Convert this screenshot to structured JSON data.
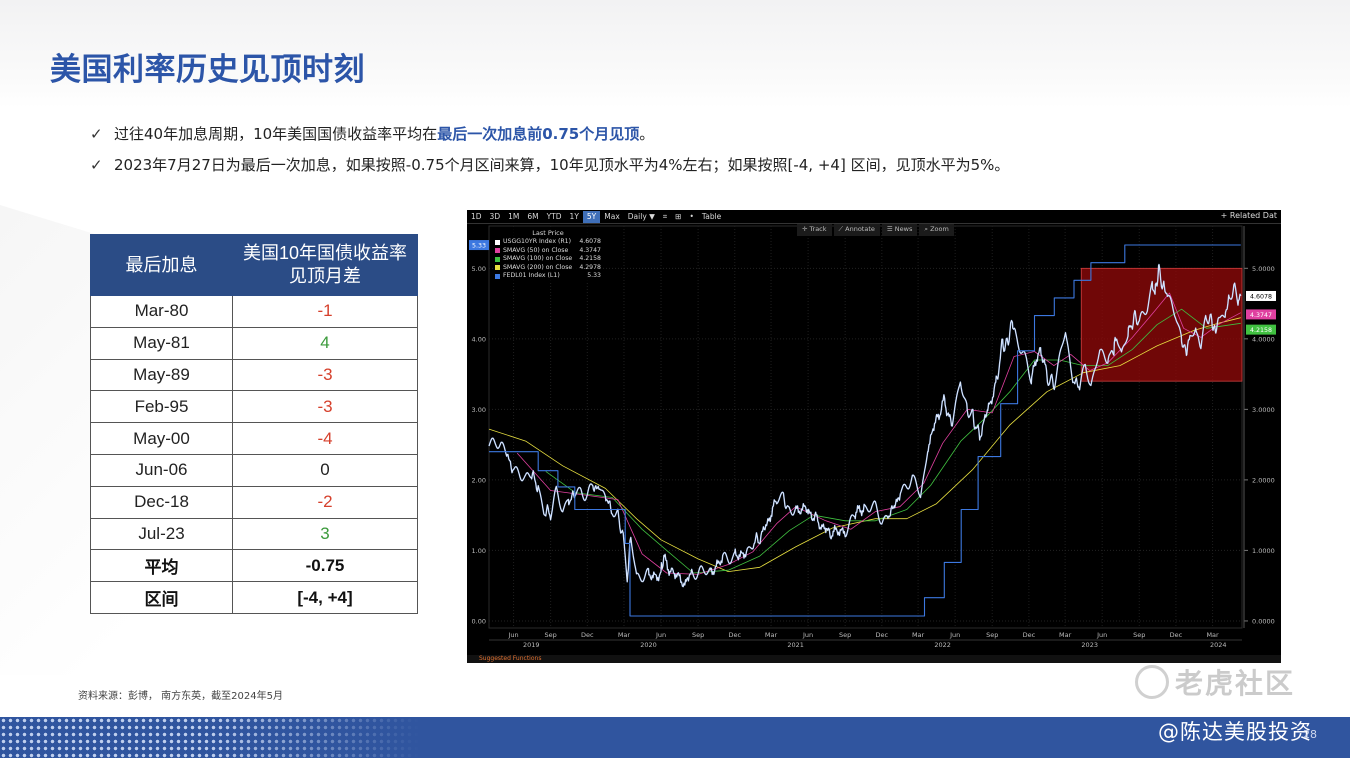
{
  "title": "美国利率历史见顶时刻",
  "bullets": [
    {
      "check": "✓",
      "text_before": "过往40年加息周期，10年美国国债收益率平均在",
      "highlight": "最后一次加息前0.75个月见顶",
      "text_after": "。"
    },
    {
      "check": "✓",
      "text_before": "2023年7月27日为最后一次加息，如果按照-0.75个月区间来算，10年见顶水平为4%左右；如果按照[-4, +4] 区间，见顶水平为5%。",
      "highlight": "",
      "text_after": ""
    }
  ],
  "table": {
    "headers": [
      "最后加息",
      "美国10年国债收益率\n见顶月差"
    ],
    "rows": [
      {
        "date": "Mar-80",
        "diff": "-1",
        "sign": "neg"
      },
      {
        "date": "May-81",
        "diff": "4",
        "sign": "pos"
      },
      {
        "date": "May-89",
        "diff": "-3",
        "sign": "neg"
      },
      {
        "date": "Feb-95",
        "diff": "-3",
        "sign": "neg"
      },
      {
        "date": "May-00",
        "diff": "-4",
        "sign": "neg"
      },
      {
        "date": "Jun-06",
        "diff": "0",
        "sign": "zero"
      },
      {
        "date": "Dec-18",
        "diff": "-2",
        "sign": "neg"
      },
      {
        "date": "Jul-23",
        "diff": "3",
        "sign": "pos"
      }
    ],
    "summary": [
      {
        "label": "平均",
        "value": "-0.75"
      },
      {
        "label": "区间",
        "value": "[-4, +4]"
      }
    ]
  },
  "terminal": {
    "toolbar": [
      "1D",
      "3D",
      "1M",
      "6M",
      "YTD",
      "1Y",
      "5Y",
      "Max",
      "Daily ▼",
      "⌗",
      "⊞",
      "•",
      "Table"
    ],
    "active_period": "5Y",
    "related": "+ Related Dat",
    "tools": [
      "✛ Track",
      "⟋ Annotate",
      "☰ News",
      "⌕ Zoom"
    ],
    "bottom_text": "Suggested Functions"
  },
  "chart_data": {
    "type": "line",
    "legend_title": "Last Price",
    "legend_position": "top-left",
    "series": [
      {
        "name": "USGG10YR Index (R1)",
        "last": "4.6078",
        "color": "#ffffff"
      },
      {
        "name": "SMAVG (50) on Close",
        "last": "4.3747",
        "color": "#e040a0"
      },
      {
        "name": "SMAVG (100) on Close",
        "last": "4.2158",
        "color": "#40c040"
      },
      {
        "name": "SMAVG (200) on Close",
        "last": "4.2978",
        "color": "#e8e040"
      },
      {
        "name": "FEDL01 Index (L1)",
        "last": "5.33",
        "color": "#3c78e0"
      }
    ],
    "left_axis": {
      "ticks": [
        "0.00",
        "1.00",
        "2.00",
        "3.00",
        "4.00",
        "5.00"
      ],
      "ylim": [
        -0.1,
        5.6
      ],
      "marker": "5.33"
    },
    "right_axis": {
      "ticks": [
        "0.0000",
        "1.0000",
        "2.0000",
        "3.0000",
        "4.0000",
        "5.0000"
      ],
      "ylim": [
        -0.1,
        5.6
      ],
      "markers": [
        {
          "value": "4.6078",
          "color": "#ffffff"
        },
        {
          "value": "4.3747",
          "color": "#e040a0"
        },
        {
          "value": "4.2158",
          "color": "#40c040"
        }
      ]
    },
    "x_month_ticks": [
      "Jun",
      "Sep",
      "Dec",
      "Mar",
      "Jun",
      "Sep",
      "Dec",
      "Mar",
      "Jun",
      "Sep",
      "Dec",
      "Mar",
      "Jun",
      "Sep",
      "Dec",
      "Mar",
      "Jun",
      "Sep",
      "Dec",
      "Mar"
    ],
    "x_year_ticks": [
      "2019",
      "2020",
      "2021",
      "2022",
      "2023",
      "2024"
    ],
    "x_range": [
      "2019-04",
      "2024-05"
    ],
    "highlight_box": {
      "x_start": "2023-04",
      "x_end": "2024-05",
      "y_range": [
        3.4,
        5.0
      ]
    },
    "ust10y": [
      [
        "2019-04-01",
        2.52
      ],
      [
        "2019-05-01",
        2.5
      ],
      [
        "2019-05-15",
        2.38
      ],
      [
        "2019-06-01",
        2.12
      ],
      [
        "2019-06-15",
        2.1
      ],
      [
        "2019-07-01",
        2.03
      ],
      [
        "2019-07-15",
        2.08
      ],
      [
        "2019-08-01",
        1.92
      ],
      [
        "2019-08-15",
        1.58
      ],
      [
        "2019-09-01",
        1.5
      ],
      [
        "2019-09-15",
        1.8
      ],
      [
        "2019-10-01",
        1.62
      ],
      [
        "2019-10-15",
        1.72
      ],
      [
        "2019-11-01",
        1.78
      ],
      [
        "2019-11-15",
        1.85
      ],
      [
        "2019-12-01",
        1.8
      ],
      [
        "2019-12-15",
        1.88
      ],
      [
        "2020-01-01",
        1.9
      ],
      [
        "2020-01-15",
        1.78
      ],
      [
        "2020-02-01",
        1.55
      ],
      [
        "2020-02-15",
        1.55
      ],
      [
        "2020-03-01",
        1.1
      ],
      [
        "2020-03-09",
        0.54
      ],
      [
        "2020-03-18",
        1.18
      ],
      [
        "2020-04-01",
        0.62
      ],
      [
        "2020-04-15",
        0.66
      ],
      [
        "2020-05-01",
        0.64
      ],
      [
        "2020-06-01",
        0.68
      ],
      [
        "2020-06-08",
        0.9
      ],
      [
        "2020-07-01",
        0.66
      ],
      [
        "2020-08-01",
        0.55
      ],
      [
        "2020-08-20",
        0.7
      ],
      [
        "2020-09-01",
        0.68
      ],
      [
        "2020-10-01",
        0.72
      ],
      [
        "2020-11-01",
        0.86
      ],
      [
        "2020-11-15",
        0.9
      ],
      [
        "2020-12-01",
        0.93
      ],
      [
        "2021-01-01",
        1.0
      ],
      [
        "2021-01-15",
        1.12
      ],
      [
        "2021-02-01",
        1.15
      ],
      [
        "2021-02-20",
        1.4
      ],
      [
        "2021-03-15",
        1.68
      ],
      [
        "2021-03-31",
        1.74
      ],
      [
        "2021-04-15",
        1.58
      ],
      [
        "2021-05-01",
        1.62
      ],
      [
        "2021-06-01",
        1.55
      ],
      [
        "2021-06-20",
        1.45
      ],
      [
        "2021-07-15",
        1.3
      ],
      [
        "2021-08-01",
        1.22
      ],
      [
        "2021-09-01",
        1.3
      ],
      [
        "2021-09-25",
        1.48
      ],
      [
        "2021-10-20",
        1.65
      ],
      [
        "2021-11-15",
        1.58
      ],
      [
        "2021-12-01",
        1.44
      ],
      [
        "2021-12-15",
        1.48
      ],
      [
        "2022-01-01",
        1.62
      ],
      [
        "2022-01-20",
        1.85
      ],
      [
        "2022-02-15",
        2.02
      ],
      [
        "2022-03-07",
        1.78
      ],
      [
        "2022-03-25",
        2.45
      ],
      [
        "2022-04-15",
        2.85
      ],
      [
        "2022-05-06",
        3.12
      ],
      [
        "2022-05-25",
        2.75
      ],
      [
        "2022-06-14",
        3.48
      ],
      [
        "2022-06-30",
        2.98
      ],
      [
        "2022-07-15",
        2.92
      ],
      [
        "2022-08-01",
        2.6
      ],
      [
        "2022-08-20",
        2.98
      ],
      [
        "2022-09-10",
        3.32
      ],
      [
        "2022-09-27",
        3.95
      ],
      [
        "2022-10-10",
        3.9
      ],
      [
        "2022-10-21",
        4.25
      ],
      [
        "2022-11-01",
        4.05
      ],
      [
        "2022-11-15",
        3.8
      ],
      [
        "2022-12-07",
        3.42
      ],
      [
        "2022-12-30",
        3.88
      ],
      [
        "2023-01-18",
        3.4
      ],
      [
        "2023-02-02",
        3.4
      ],
      [
        "2023-03-02",
        4.08
      ],
      [
        "2023-03-20",
        3.45
      ],
      [
        "2023-04-06",
        3.3
      ],
      [
        "2023-04-20",
        3.58
      ],
      [
        "2023-05-04",
        3.38
      ],
      [
        "2023-05-26",
        3.8
      ],
      [
        "2023-06-15",
        3.72
      ],
      [
        "2023-06-30",
        3.84
      ],
      [
        "2023-07-07",
        4.06
      ],
      [
        "2023-07-19",
        3.76
      ],
      [
        "2023-08-04",
        4.05
      ],
      [
        "2023-08-21",
        4.34
      ],
      [
        "2023-09-01",
        4.18
      ],
      [
        "2023-09-21",
        4.48
      ],
      [
        "2023-10-03",
        4.8
      ],
      [
        "2023-10-10",
        4.62
      ],
      [
        "2023-10-19",
        4.98
      ],
      [
        "2023-11-01",
        4.75
      ],
      [
        "2023-11-10",
        4.62
      ],
      [
        "2023-11-30",
        4.35
      ],
      [
        "2023-12-14",
        4.0
      ],
      [
        "2023-12-27",
        3.8
      ],
      [
        "2024-01-05",
        4.05
      ],
      [
        "2024-01-19",
        4.15
      ],
      [
        "2024-02-01",
        3.9
      ],
      [
        "2024-02-13",
        4.3
      ],
      [
        "2024-02-28",
        4.25
      ],
      [
        "2024-03-08",
        4.08
      ],
      [
        "2024-03-19",
        4.3
      ],
      [
        "2024-04-01",
        4.33
      ],
      [
        "2024-04-10",
        4.55
      ],
      [
        "2024-04-25",
        4.7
      ],
      [
        "2024-05-03",
        4.5
      ],
      [
        "2024-05-10",
        4.61
      ]
    ],
    "fed_funds": [
      [
        "2019-04-01",
        2.4
      ],
      [
        "2019-08-01",
        2.4
      ],
      [
        "2019-08-01",
        2.13
      ],
      [
        "2019-09-19",
        2.13
      ],
      [
        "2019-09-19",
        1.9
      ],
      [
        "2019-10-31",
        1.9
      ],
      [
        "2019-10-31",
        1.58
      ],
      [
        "2020-03-04",
        1.58
      ],
      [
        "2020-03-04",
        1.1
      ],
      [
        "2020-03-16",
        1.1
      ],
      [
        "2020-03-16",
        0.07
      ],
      [
        "2022-03-17",
        0.07
      ],
      [
        "2022-03-17",
        0.33
      ],
      [
        "2022-05-05",
        0.33
      ],
      [
        "2022-05-05",
        0.83
      ],
      [
        "2022-06-16",
        0.83
      ],
      [
        "2022-06-16",
        1.58
      ],
      [
        "2022-07-28",
        1.58
      ],
      [
        "2022-07-28",
        2.33
      ],
      [
        "2022-09-22",
        2.33
      ],
      [
        "2022-09-22",
        3.08
      ],
      [
        "2022-11-03",
        3.08
      ],
      [
        "2022-11-03",
        3.83
      ],
      [
        "2022-12-15",
        3.83
      ],
      [
        "2022-12-15",
        4.33
      ],
      [
        "2023-02-02",
        4.33
      ],
      [
        "2023-02-02",
        4.58
      ],
      [
        "2023-03-23",
        4.58
      ],
      [
        "2023-03-23",
        4.83
      ],
      [
        "2023-05-04",
        4.83
      ],
      [
        "2023-05-04",
        5.08
      ],
      [
        "2023-07-27",
        5.08
      ],
      [
        "2023-07-27",
        5.33
      ],
      [
        "2024-05-10",
        5.33
      ]
    ],
    "smavg50": [
      [
        "2019-06-10",
        2.38
      ],
      [
        "2019-09-01",
        1.85
      ],
      [
        "2019-12-01",
        1.78
      ],
      [
        "2020-02-15",
        1.72
      ],
      [
        "2020-04-15",
        0.95
      ],
      [
        "2020-06-15",
        0.68
      ],
      [
        "2020-09-01",
        0.66
      ],
      [
        "2020-11-15",
        0.8
      ],
      [
        "2021-01-15",
        0.98
      ],
      [
        "2021-03-15",
        1.38
      ],
      [
        "2021-05-01",
        1.62
      ],
      [
        "2021-07-15",
        1.42
      ],
      [
        "2021-09-15",
        1.3
      ],
      [
        "2021-11-15",
        1.55
      ],
      [
        "2022-01-15",
        1.62
      ],
      [
        "2022-03-15",
        1.95
      ],
      [
        "2022-05-01",
        2.52
      ],
      [
        "2022-07-01",
        3.0
      ],
      [
        "2022-09-01",
        2.95
      ],
      [
        "2022-10-25",
        3.75
      ],
      [
        "2022-12-15",
        3.82
      ],
      [
        "2023-02-01",
        3.62
      ],
      [
        "2023-03-15",
        3.78
      ],
      [
        "2023-05-01",
        3.55
      ],
      [
        "2023-06-15",
        3.66
      ],
      [
        "2023-08-15",
        4.02
      ],
      [
        "2023-10-10",
        4.4
      ],
      [
        "2023-11-15",
        4.65
      ],
      [
        "2023-12-20",
        4.15
      ],
      [
        "2024-02-01",
        4.02
      ],
      [
        "2024-03-15",
        4.2
      ],
      [
        "2024-05-10",
        4.37
      ]
    ],
    "smavg100": [
      [
        "2019-08-20",
        2.12
      ],
      [
        "2019-11-01",
        1.82
      ],
      [
        "2020-02-01",
        1.75
      ],
      [
        "2020-04-15",
        1.3
      ],
      [
        "2020-06-15",
        1.0
      ],
      [
        "2020-08-20",
        0.68
      ],
      [
        "2020-11-15",
        0.72
      ],
      [
        "2021-02-01",
        0.92
      ],
      [
        "2021-04-15",
        1.28
      ],
      [
        "2021-06-15",
        1.5
      ],
      [
        "2021-09-01",
        1.42
      ],
      [
        "2021-11-15",
        1.42
      ],
      [
        "2022-02-01",
        1.58
      ],
      [
        "2022-04-01",
        1.92
      ],
      [
        "2022-06-15",
        2.55
      ],
      [
        "2022-08-15",
        2.88
      ],
      [
        "2022-10-15",
        3.25
      ],
      [
        "2022-12-15",
        3.7
      ],
      [
        "2023-02-15",
        3.7
      ],
      [
        "2023-04-15",
        3.62
      ],
      [
        "2023-06-15",
        3.62
      ],
      [
        "2023-08-15",
        3.85
      ],
      [
        "2023-10-15",
        4.2
      ],
      [
        "2023-12-15",
        4.42
      ],
      [
        "2024-02-15",
        4.15
      ],
      [
        "2024-05-10",
        4.22
      ]
    ],
    "smavg200": [
      [
        "2019-04-01",
        2.72
      ],
      [
        "2019-07-01",
        2.55
      ],
      [
        "2019-10-01",
        2.2
      ],
      [
        "2020-01-15",
        1.88
      ],
      [
        "2020-04-01",
        1.45
      ],
      [
        "2020-06-01",
        1.15
      ],
      [
        "2020-09-01",
        0.88
      ],
      [
        "2020-11-15",
        0.7
      ],
      [
        "2021-02-01",
        0.76
      ],
      [
        "2021-05-01",
        1.05
      ],
      [
        "2021-08-01",
        1.32
      ],
      [
        "2021-11-15",
        1.45
      ],
      [
        "2022-02-01",
        1.45
      ],
      [
        "2022-04-15",
        1.66
      ],
      [
        "2022-07-15",
        2.15
      ],
      [
        "2022-10-15",
        2.78
      ],
      [
        "2023-01-15",
        3.25
      ],
      [
        "2023-04-15",
        3.52
      ],
      [
        "2023-07-15",
        3.62
      ],
      [
        "2023-10-15",
        3.9
      ],
      [
        "2024-01-15",
        4.12
      ],
      [
        "2024-03-15",
        4.22
      ],
      [
        "2024-05-10",
        4.3
      ]
    ]
  },
  "source": "资料来源：彭博， 南方东英，截至2024年5月",
  "watermark": {
    "brand": "老虎社区",
    "handle": "@陈达美股投资"
  },
  "page_number": "28"
}
